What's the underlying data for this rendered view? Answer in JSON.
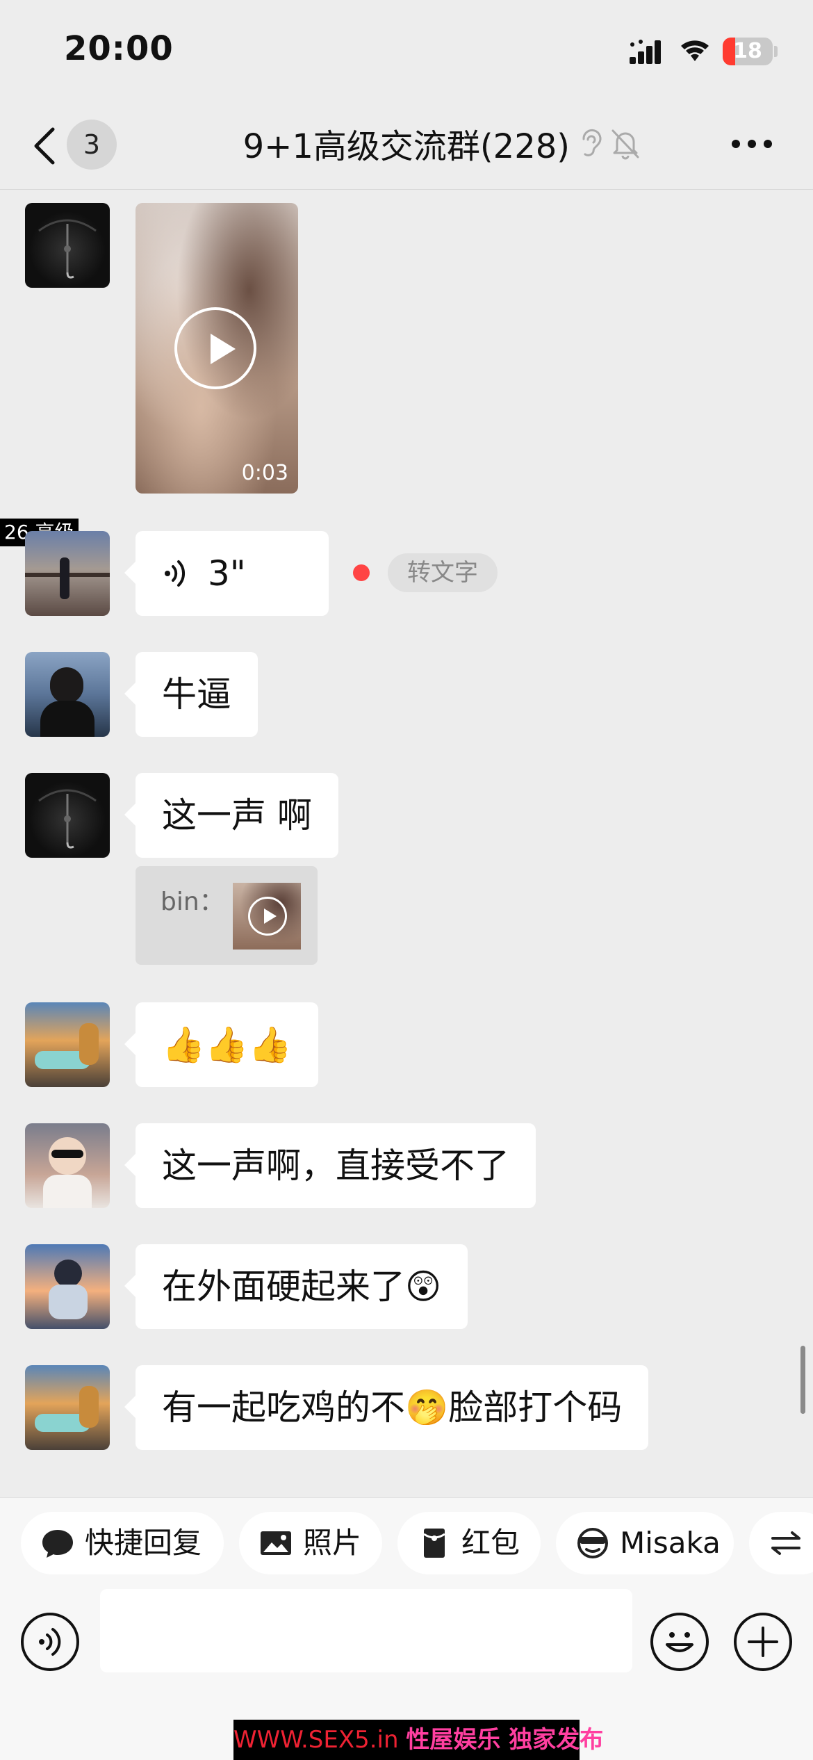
{
  "status_bar": {
    "time": "20:00",
    "battery_level": "18"
  },
  "nav": {
    "back_badge": "3",
    "title": "9+1高级交流群(228)",
    "icons": [
      "ear-icon",
      "mute-bell-icon",
      "more-icon"
    ]
  },
  "messages": [
    {
      "type": "video",
      "sender_avatar": "umbrella-dark",
      "duration": "0:03"
    },
    {
      "type": "voice",
      "sender_tag": "26,高级",
      "duration": "3\"",
      "action": "转文字",
      "unread": true
    },
    {
      "type": "text",
      "text": "牛逼"
    },
    {
      "type": "text",
      "text": "这一声 啊",
      "quote": {
        "label": "bin：",
        "media": "video"
      }
    },
    {
      "type": "text",
      "text": "👍👍👍"
    },
    {
      "type": "text",
      "text": "这一声啊，直接受不了"
    },
    {
      "type": "text",
      "text": "在外面硬起来了😲"
    },
    {
      "type": "text",
      "text": "有一起吃鸡的不🤭脸部打个码"
    }
  ],
  "quick_actions": [
    {
      "label": "快捷回复",
      "icon": "chat-bubble-icon"
    },
    {
      "label": "照片",
      "icon": "image-icon"
    },
    {
      "label": "红包",
      "icon": "red-packet-icon"
    },
    {
      "label": "Misaka",
      "icon": "sunglasses-face-icon"
    },
    {
      "label": "",
      "icon": "swap-arrows-icon"
    }
  ],
  "input_bar": {
    "placeholder": ""
  },
  "watermark": {
    "url": "WWW.SEX5.in",
    "text": "性屋娱乐 独家发布"
  },
  "colors": {
    "background": "#ededed",
    "bubble": "#ffffff",
    "unread_dot": "#ff4444"
  }
}
